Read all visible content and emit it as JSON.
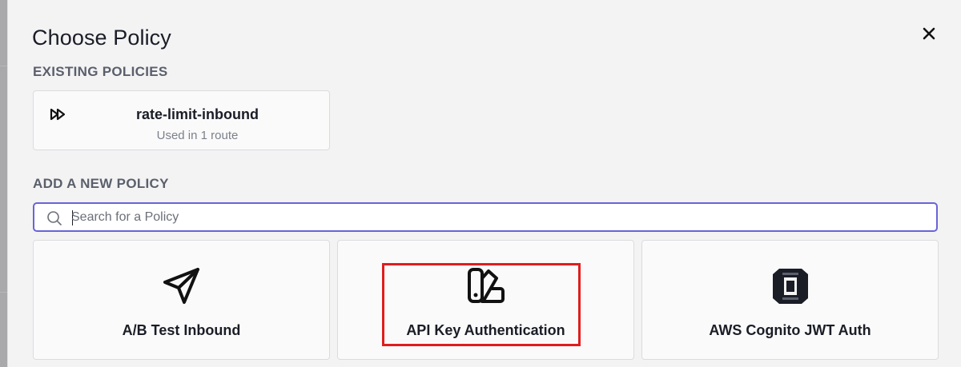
{
  "dialog": {
    "title": "Choose Policy",
    "close_icon": "close-icon"
  },
  "existing": {
    "section_label": "EXISTING POLICIES",
    "policies": [
      {
        "name": "rate-limit-inbound",
        "usage": "Used in 1 route",
        "icon": "fast-forward-icon"
      }
    ]
  },
  "add_new": {
    "section_label": "ADD A NEW POLICY",
    "search": {
      "placeholder": "Search for a Policy",
      "value": ""
    },
    "policies": [
      {
        "label": "A/B Test Inbound",
        "icon": "paper-plane-icon"
      },
      {
        "label": "API Key Authentication",
        "icon": "swatchbook-icon"
      },
      {
        "label": "AWS Cognito JWT Auth",
        "icon": "aws-cognito-icon"
      }
    ]
  },
  "colors": {
    "accent": "#6a63d8",
    "highlight": "#e01d1d",
    "text": "#1a1d26",
    "muted": "#5a5f6b"
  }
}
